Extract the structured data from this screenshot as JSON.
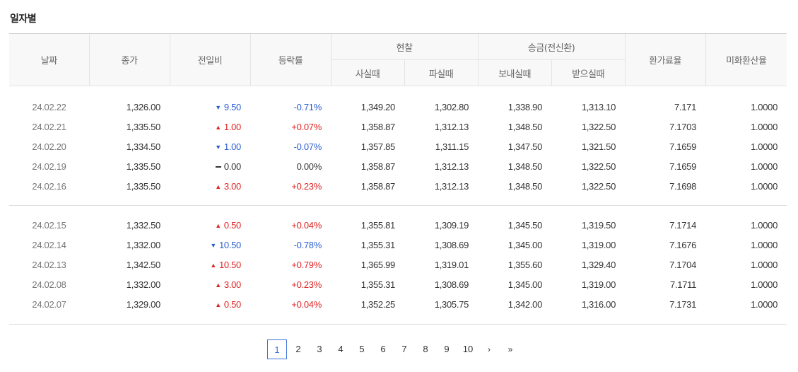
{
  "section_title": "일자별",
  "headers": {
    "date": "날짜",
    "close": "종가",
    "diff": "전일비",
    "rate": "등락률",
    "cash": "현찰",
    "cash_buy": "사실때",
    "cash_sell": "파실때",
    "remit": "송금(전신환)",
    "remit_send": "보내실때",
    "remit_recv": "받으실때",
    "fx_rate": "환가료율",
    "usd_rate": "미화환산율"
  },
  "groups": [
    [
      {
        "date": "24.02.22",
        "close": "1,326.00",
        "dir": "down",
        "diff": "9.50",
        "rate": "-0.71%",
        "buy": "1,349.20",
        "sell": "1,302.80",
        "send": "1,338.90",
        "recv": "1,313.10",
        "fx": "7.171",
        "usd": "1.0000"
      },
      {
        "date": "24.02.21",
        "close": "1,335.50",
        "dir": "up",
        "diff": "1.00",
        "rate": "+0.07%",
        "buy": "1,358.87",
        "sell": "1,312.13",
        "send": "1,348.50",
        "recv": "1,322.50",
        "fx": "7.1703",
        "usd": "1.0000"
      },
      {
        "date": "24.02.20",
        "close": "1,334.50",
        "dir": "down",
        "diff": "1.00",
        "rate": "-0.07%",
        "buy": "1,357.85",
        "sell": "1,311.15",
        "send": "1,347.50",
        "recv": "1,321.50",
        "fx": "7.1659",
        "usd": "1.0000"
      },
      {
        "date": "24.02.19",
        "close": "1,335.50",
        "dir": "even",
        "diff": "0.00",
        "rate": "0.00%",
        "buy": "1,358.87",
        "sell": "1,312.13",
        "send": "1,348.50",
        "recv": "1,322.50",
        "fx": "7.1659",
        "usd": "1.0000"
      },
      {
        "date": "24.02.16",
        "close": "1,335.50",
        "dir": "up",
        "diff": "3.00",
        "rate": "+0.23%",
        "buy": "1,358.87",
        "sell": "1,312.13",
        "send": "1,348.50",
        "recv": "1,322.50",
        "fx": "7.1698",
        "usd": "1.0000"
      }
    ],
    [
      {
        "date": "24.02.15",
        "close": "1,332.50",
        "dir": "up",
        "diff": "0.50",
        "rate": "+0.04%",
        "buy": "1,355.81",
        "sell": "1,309.19",
        "send": "1,345.50",
        "recv": "1,319.50",
        "fx": "7.1714",
        "usd": "1.0000"
      },
      {
        "date": "24.02.14",
        "close": "1,332.00",
        "dir": "down",
        "diff": "10.50",
        "rate": "-0.78%",
        "buy": "1,355.31",
        "sell": "1,308.69",
        "send": "1,345.00",
        "recv": "1,319.00",
        "fx": "7.1676",
        "usd": "1.0000"
      },
      {
        "date": "24.02.13",
        "close": "1,342.50",
        "dir": "up",
        "diff": "10.50",
        "rate": "+0.79%",
        "buy": "1,365.99",
        "sell": "1,319.01",
        "send": "1,355.60",
        "recv": "1,329.40",
        "fx": "7.1704",
        "usd": "1.0000"
      },
      {
        "date": "24.02.08",
        "close": "1,332.00",
        "dir": "up",
        "diff": "3.00",
        "rate": "+0.23%",
        "buy": "1,355.31",
        "sell": "1,308.69",
        "send": "1,345.00",
        "recv": "1,319.00",
        "fx": "7.1711",
        "usd": "1.0000"
      },
      {
        "date": "24.02.07",
        "close": "1,329.00",
        "dir": "up",
        "diff": "0.50",
        "rate": "+0.04%",
        "buy": "1,352.25",
        "sell": "1,305.75",
        "send": "1,342.00",
        "recv": "1,316.00",
        "fx": "7.1731",
        "usd": "1.0000"
      }
    ]
  ],
  "pagination": {
    "pages": [
      "1",
      "2",
      "3",
      "4",
      "5",
      "6",
      "7",
      "8",
      "9",
      "10"
    ],
    "current": "1",
    "next_label": "›",
    "last_label": "»"
  },
  "colors": {
    "up": "#e02424",
    "down": "#2b5fd0",
    "active_page": "#3a72d8"
  },
  "icons": {
    "up": "triangle-up-icon",
    "down": "triangle-down-icon",
    "even": "dash-icon",
    "next": "chevron-right-icon",
    "last": "double-chevron-right-icon"
  }
}
